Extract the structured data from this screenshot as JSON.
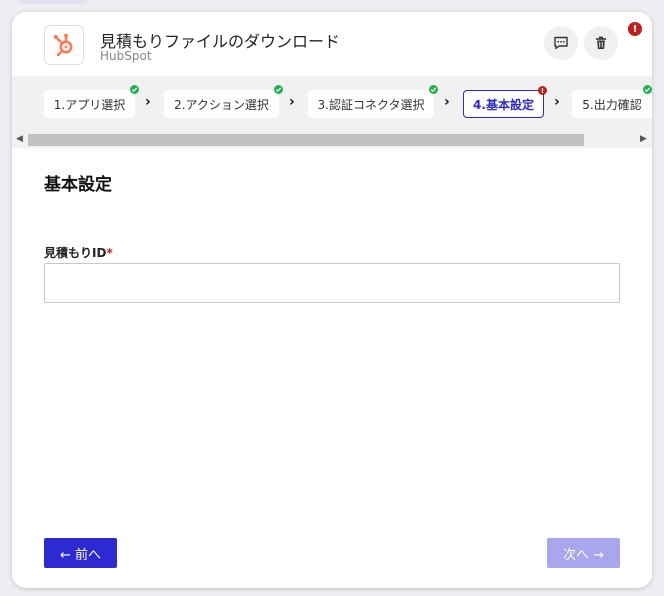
{
  "header": {
    "title": "見積もりファイルのダウンロード",
    "subtitle": "HubSpot",
    "alert_text": "!"
  },
  "steps": [
    {
      "label": "1.アプリ選択",
      "status": "complete"
    },
    {
      "label": "2.アクション選択",
      "status": "complete"
    },
    {
      "label": "3.認証コネクタ選択",
      "status": "complete"
    },
    {
      "label": "4.基本設定",
      "status": "error",
      "active": true
    },
    {
      "label": "5.出力確認",
      "status": "complete"
    }
  ],
  "step_error_badge": "!",
  "content": {
    "section_title": "基本設定",
    "field_label": "見積もりID",
    "field_required_mark": "*",
    "field_value": "",
    "field_placeholder": ""
  },
  "footer": {
    "back_label": "← 前へ",
    "next_label": "次へ →"
  },
  "colors": {
    "accent": "#2d2ad1",
    "accent_disabled": "#a8a6ec",
    "hubspot_orange": "#ff7a59",
    "success": "#22b14c",
    "error": "#c21d1d"
  }
}
